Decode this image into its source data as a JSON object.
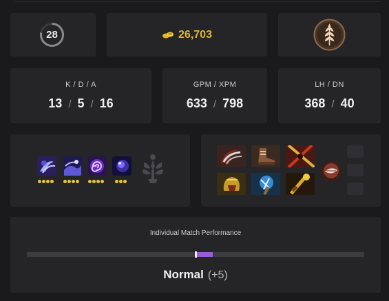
{
  "level": {
    "value": "28",
    "progress": 0.78
  },
  "gold": {
    "icon": "gold-coins-icon",
    "value": "26,703",
    "color": "#e2b52f"
  },
  "rank": {
    "icon": "wheat-rank-emblem-icon"
  },
  "kda": {
    "label": "K / D / A",
    "kills": "13",
    "deaths": "5",
    "assists": "16",
    "separator": "/"
  },
  "gpm_xpm": {
    "label": "GPM / XPM",
    "gpm": "633",
    "xpm": "798",
    "separator": "/"
  },
  "lh_dn": {
    "label": "LH / DN",
    "lh": "368",
    "dn": "40",
    "separator": "/"
  },
  "abilities": [
    {
      "icon": "void-vortex-ability-icon",
      "levels": 4
    },
    {
      "icon": "void-wave-ability-icon",
      "levels": 4
    },
    {
      "icon": "void-spiral-ability-icon",
      "levels": 4
    },
    {
      "icon": "void-orb-ultimate-icon",
      "levels": 3
    }
  ],
  "talent": {
    "icon": "talent-tree-icon"
  },
  "items": [
    {
      "icon": "claw-item-icon"
    },
    {
      "icon": "boots-item-icon"
    },
    {
      "icon": "crossed-blades-item-icon"
    },
    {
      "icon": "golden-helm-item-icon"
    },
    {
      "icon": "frost-hammer-item-icon"
    },
    {
      "icon": "golden-staff-item-icon"
    }
  ],
  "neutral_item": {
    "icon": "neutral-orb-item-icon"
  },
  "backpack_slots": 3,
  "performance": {
    "title": "Individual Match Performance",
    "rating": "Normal",
    "delta": "(+5)",
    "marker": 0.5,
    "fill": 0.05,
    "accent": "#9b5bd8"
  }
}
